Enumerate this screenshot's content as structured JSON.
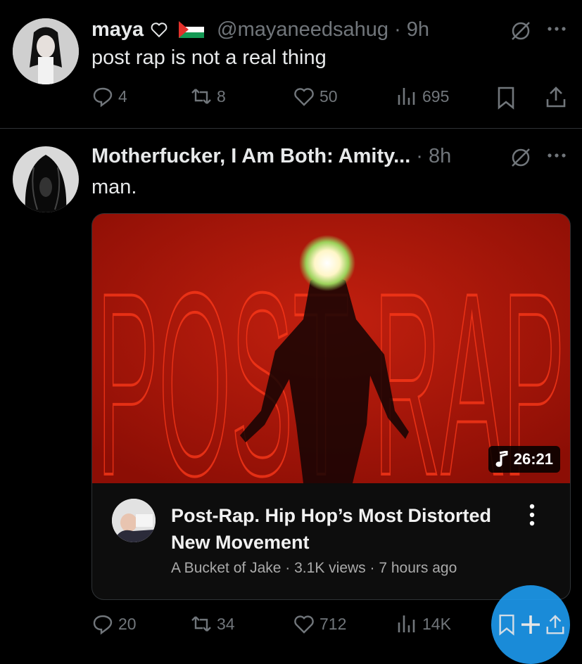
{
  "tweet1": {
    "name": "maya",
    "handle": "@mayaneedsahug",
    "time": "9h",
    "text": "post rap is not a real thing",
    "actions": {
      "replies": "4",
      "reposts": "8",
      "likes": "50",
      "views": "695"
    }
  },
  "tweet2": {
    "name": "Motherfucker, I Am Both: Amity...",
    "time": "8h",
    "text": "man.",
    "video": {
      "thumb_text": "POST RAP",
      "duration": "26:21",
      "title": "Post-Rap. Hip Hop’s Most Distorted New Movement",
      "channel": "A Bucket of Jake",
      "views": "3.1K views",
      "age": "7 hours ago"
    },
    "actions": {
      "replies": "20",
      "reposts": "34",
      "likes": "712",
      "views": "14K"
    }
  },
  "separator": "·",
  "colors": {
    "background": "#000000",
    "muted": "#71767b",
    "accent": "#1d9bf0",
    "thumb_red": "#b31509"
  }
}
